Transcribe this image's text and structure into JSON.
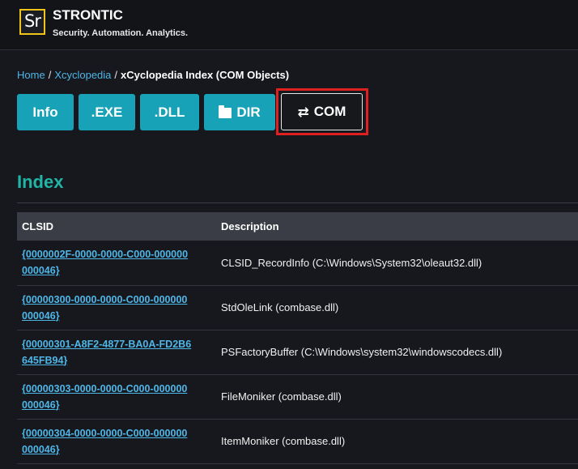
{
  "header": {
    "logo_text": "Sr",
    "brand_name": "STRONTIC",
    "tagline": "Security. Automation. Analytics."
  },
  "breadcrumb": {
    "home": "Home",
    "sep": "/",
    "section": "Xcyclopedia",
    "current": "xCyclopedia Index (COM Objects)"
  },
  "nav_buttons": {
    "info": "Info",
    "exe": ".EXE",
    "dll": ".DLL",
    "dir": "DIR",
    "com": "COM",
    "dir_icon": "folder-icon",
    "com_icon": "arrows-exchange-icon"
  },
  "section_title": "Index",
  "table": {
    "headers": [
      "CLSID",
      "Description"
    ],
    "rows": [
      {
        "clsid_line1": "{0000002F-0000-0000-C000-",
        "clsid_line2": "000000000046}",
        "description": "CLSID_RecordInfo (C:\\Windows\\System32\\oleaut32.dll)"
      },
      {
        "clsid_line1": "{00000300-0000-0000-C000-",
        "clsid_line2": "000000000046}",
        "description": "StdOleLink (combase.dll)"
      },
      {
        "clsid_line1": "{00000301-A8F2-4877-BA0A-",
        "clsid_line2": "FD2B6645FB94}",
        "description": "PSFactoryBuffer (C:\\Windows\\system32\\windowscodecs.dll)"
      },
      {
        "clsid_line1": "{00000303-0000-0000-C000-",
        "clsid_line2": "000000000046}",
        "description": "FileMoniker (combase.dll)"
      },
      {
        "clsid_line1": "{00000304-0000-0000-C000-",
        "clsid_line2": "000000000046}",
        "description": "ItemMoniker (combase.dll)"
      }
    ]
  },
  "colors": {
    "background": "#16181d",
    "accent_teal": "#17a2b8",
    "heading_teal": "#20b5a5",
    "link_blue": "#4fb6e8",
    "highlight_red": "#e0201f"
  }
}
